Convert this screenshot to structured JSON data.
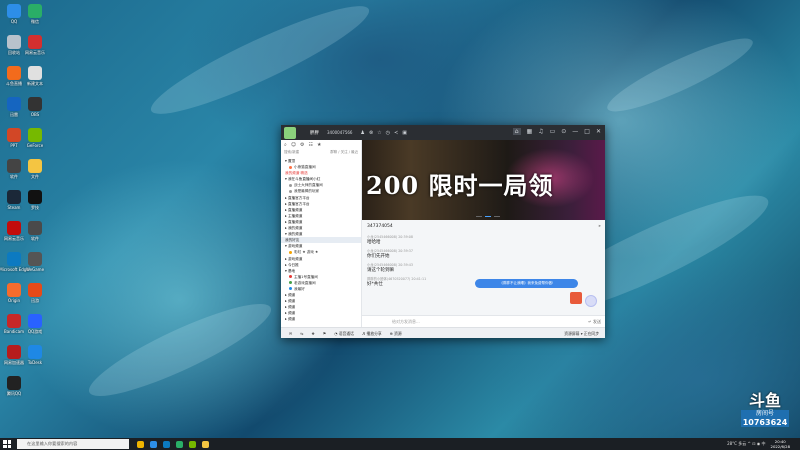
{
  "desktop": {
    "icons_col1": [
      {
        "label": "QQ",
        "color": "#2d8ee8"
      },
      {
        "label": "回收站",
        "color": "#b8c2cc"
      },
      {
        "label": "斗鱼直播",
        "color": "#f36b1c"
      },
      {
        "label": "迅雷",
        "color": "#1565c0"
      },
      {
        "label": "PPT",
        "color": "#d24726"
      },
      {
        "label": "软件",
        "color": "#444"
      },
      {
        "label": "Steam",
        "color": "#1b2838"
      },
      {
        "label": "网易云音乐",
        "color": "#c20c0c"
      },
      {
        "label": "Microsoft Edge",
        "color": "#0c7ac1"
      },
      {
        "label": "Origin",
        "color": "#f56c2d"
      },
      {
        "label": "Bandicam",
        "color": "#c62828"
      },
      {
        "label": "网易加速器",
        "color": "#b71c1c"
      },
      {
        "label": "腾讯QQ",
        "color": "#222"
      }
    ],
    "icons_col2": [
      {
        "label": "微信",
        "color": "#2aae67"
      },
      {
        "label": "网易云音乐",
        "color": "#d32f2f"
      },
      {
        "label": "新建文本",
        "color": "#e0e0e0"
      },
      {
        "label": "OBS",
        "color": "#333"
      },
      {
        "label": "GeForce",
        "color": "#76b900"
      },
      {
        "label": "文件",
        "color": "#f4c542"
      },
      {
        "label": "罗技",
        "color": "#111"
      },
      {
        "label": "软件",
        "color": "#4a4a4a"
      },
      {
        "label": "WeGame",
        "color": "#555"
      },
      {
        "label": "迅游",
        "color": "#e64a19"
      },
      {
        "label": "QQ游戏",
        "color": "#2962ff"
      },
      {
        "label": "ToDesk",
        "color": "#1e88e5"
      }
    ]
  },
  "qq": {
    "title_name": "胖胖",
    "title_id": "3400047566",
    "title_icons": [
      "♟",
      "⊗",
      "☆",
      "◷",
      "≺",
      "▣"
    ],
    "title_right": [
      "⌂",
      "▦",
      "♫",
      "▭",
      "⊙",
      "—",
      "□",
      "✕"
    ],
    "toolbar_icons": [
      "⌕",
      "☺",
      "⚙",
      "☷",
      "★"
    ],
    "search_hint": "搜索/新建",
    "search_right": "群聊 / 关注 / 最近",
    "contacts": [
      {
        "text": "▾ 置顶",
        "type": "group"
      },
      {
        "text": "小熊猫直播间",
        "type": "item",
        "color": "#ff7043"
      },
      {
        "text": "我的频道·精选",
        "type": "hl"
      },
      {
        "text": "▾ 我在斗鱼直播间小红",
        "type": "group"
      },
      {
        "text": "战士大师的直播间",
        "type": "item"
      },
      {
        "text": "我是最棒的玩家",
        "type": "item"
      },
      {
        "text": "▸ 直播官方平台",
        "type": "group"
      },
      {
        "text": "▸ 直播官方平台",
        "type": "group"
      },
      {
        "text": "▸ 直播频道",
        "type": "group"
      },
      {
        "text": "▸ 主播频道",
        "type": "group"
      },
      {
        "text": "▸ 直播频道",
        "type": "group"
      },
      {
        "text": "▸ 我的频道",
        "type": "group"
      },
      {
        "text": "▾ 我的频道",
        "type": "group"
      },
      {
        "text": "我的好友",
        "type": "sel"
      },
      {
        "text": "▾ 游戏频道",
        "type": "group"
      },
      {
        "text": "彩虹 ★ 游戏 ★",
        "type": "item",
        "color": "#f4a300"
      },
      {
        "text": "▸ 游戏频道",
        "type": "group"
      },
      {
        "text": "▸ 今日推",
        "type": "group"
      },
      {
        "text": "▾ 基地",
        "type": "group"
      },
      {
        "text": "主播1号直播间",
        "type": "item",
        "color": "#e53935"
      },
      {
        "text": "老游戏直播间",
        "type": "item",
        "color": "#43a047"
      },
      {
        "text": "我最好",
        "type": "item",
        "color": "#1e88e5"
      },
      {
        "text": "▸ 频道",
        "type": "group"
      },
      {
        "text": "▸ 频道",
        "type": "group"
      },
      {
        "text": "▸ 频道",
        "type": "group"
      },
      {
        "text": "▸ 频道",
        "type": "group"
      },
      {
        "text": "▸ 频道",
        "type": "group"
      }
    ],
    "banner_text": "200 限时一局领",
    "chat_title": "347374054",
    "messages": [
      {
        "meta": "小龙(2545466008)  20:39:08",
        "text": "哈哈哈"
      },
      {
        "meta": "小龙(2545466008)  20:39:37",
        "text": "你们先开始"
      },
      {
        "meta": "小龙(2545466008)  20:39:43",
        "text": "请这个轮到嘛"
      },
      {
        "meta": "胖胖的小团体(4670520077)  20:41:11",
        "text": "好*共仕"
      }
    ],
    "bubble_text": "《胖胖不让我睡》我来免费帮你做!",
    "input_placeholder": "给对方发消息...",
    "send_hint": "↵ 发送",
    "bottom_items": [
      "✉",
      "⇆",
      "❖",
      "⚑",
      "◔ 语音通话",
      "♬ 播放分享",
      "⊕ 资源"
    ],
    "bottom_right": "资源屏幕  ▾     正在同步"
  },
  "watermark": {
    "logo": "斗鱼",
    "sub": "房间号",
    "room": "10763624"
  },
  "taskbar": {
    "search_text": "在这里输入你要搜索的内容",
    "apps": [
      "#f0b400",
      "#2d8ee8",
      "#0c7ac1",
      "#2aae67",
      "#76b900",
      "#f4c542"
    ],
    "tray": "28°C 多云  ^  ⊡  ◉  中",
    "time": "20:40",
    "date": "2022/6/28"
  }
}
